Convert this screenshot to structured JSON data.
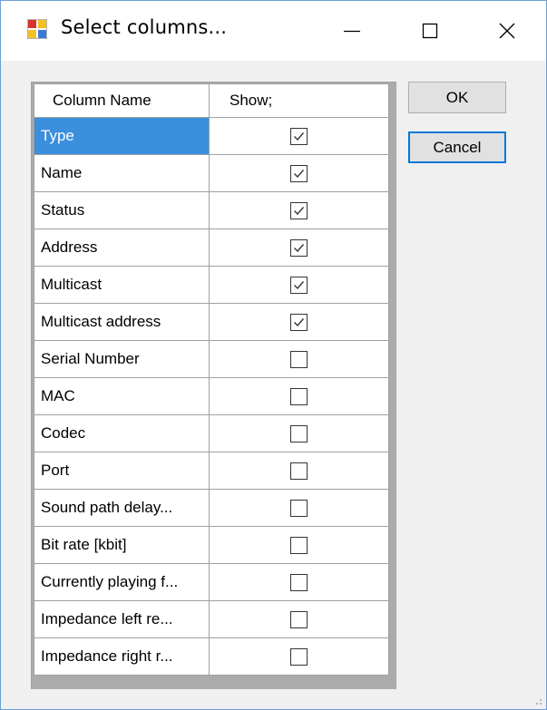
{
  "window": {
    "title": "Select columns...",
    "colors": {
      "border": "#6e9fd6",
      "selection": "#3b8fdc",
      "focus": "#0078d7"
    }
  },
  "titlebar_buttons": {
    "minimize": "minimize-icon",
    "maximize": "maximize-icon",
    "close": "close-icon"
  },
  "grid": {
    "headers": {
      "name": "Column Name",
      "show": "Show;"
    },
    "selected_index": 0,
    "rows": [
      {
        "name": "Type",
        "show": true
      },
      {
        "name": "Name",
        "show": true
      },
      {
        "name": "Status",
        "show": true
      },
      {
        "name": "Address",
        "show": true
      },
      {
        "name": "Multicast",
        "show": true
      },
      {
        "name": "Multicast address",
        "show": true
      },
      {
        "name": "Serial Number",
        "show": false
      },
      {
        "name": "MAC",
        "show": false
      },
      {
        "name": "Codec",
        "show": false
      },
      {
        "name": "Port",
        "show": false
      },
      {
        "name": "Sound path delay...",
        "show": false
      },
      {
        "name": "Bit rate [kbit]",
        "show": false
      },
      {
        "name": "Currently playing f...",
        "show": false
      },
      {
        "name": "Impedance left re...",
        "show": false
      },
      {
        "name": "Impedance right r...",
        "show": false
      }
    ]
  },
  "buttons": {
    "ok": "OK",
    "cancel": "Cancel"
  }
}
